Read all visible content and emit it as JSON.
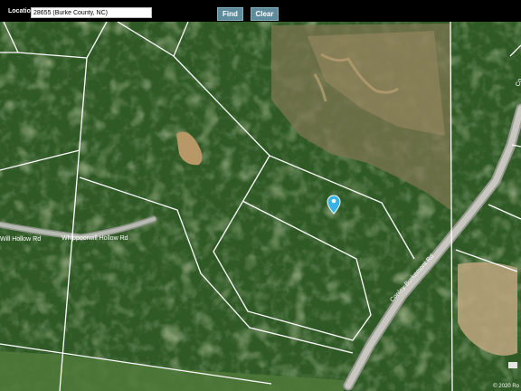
{
  "toolbar": {
    "location_label": "Location:",
    "location_value": "28655 (Burke County, NC)",
    "find_label": "Find",
    "clear_label": "Clear"
  },
  "map": {
    "roads": {
      "whippoorwill_left": "Will Hollow Rd",
      "whippoorwill_main": "Whippoorwill Hollow Rd",
      "burkemont": "Conley Burkemont Rd",
      "upper_right": "Co"
    },
    "credit": "© 2020 Ro",
    "marker_icon": "location-pin-icon",
    "colors": {
      "forest": "#2f5a25",
      "clearing": "#8a7a55",
      "parcel_line": "#ffffff",
      "marker": "#38b3e8"
    }
  }
}
